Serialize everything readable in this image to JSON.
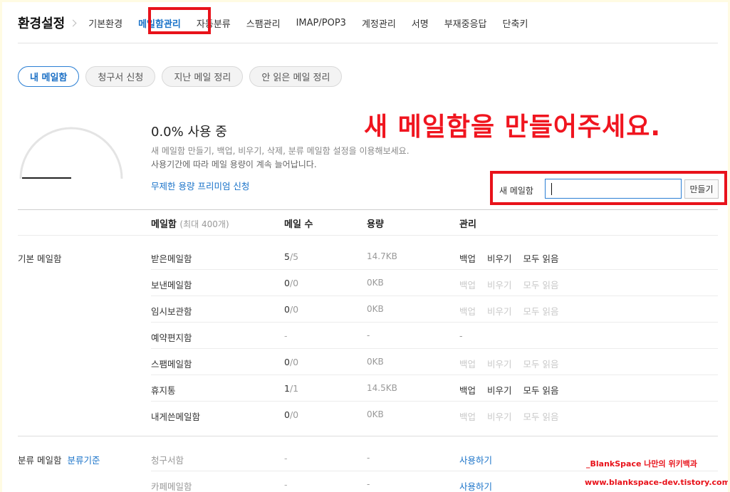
{
  "nav": {
    "title": "환경설정",
    "items": [
      "기본환경",
      "메일함관리",
      "자동분류",
      "스팸관리",
      "IMAP/POP3",
      "계정관리",
      "서명",
      "부재중응답",
      "단축키"
    ]
  },
  "tabs": [
    "내 메일함",
    "청구서 신청",
    "지난 메일 정리",
    "안 읽은 메일 정리"
  ],
  "usage": {
    "title": "0.0% 사용 중",
    "percent": 0.0,
    "desc1": "새 메일함 만들기, 백업, 비우기, 삭제, 분류 메일함 설정을 이용해보세요.",
    "desc2": "사용기간에 따라 메일 용량이 계속 늘어납니다.",
    "premium_link": "무제한 용량 프리미엄 신청"
  },
  "overlay_message": "새 메일함을 만들어주세요.",
  "new_mailbox": {
    "label": "새 메일함",
    "value": "",
    "button": "만들기"
  },
  "table": {
    "headers": {
      "mailbox": "메일함",
      "mailbox_sub": "(최대 400개)",
      "count": "메일 수",
      "size": "용량",
      "manage": "관리"
    },
    "groups": [
      {
        "label": "기본 메일함",
        "rows": [
          {
            "name": "받은메일함",
            "count": "5",
            "total": "/5",
            "size": "14.7KB",
            "actions": [
              "백업",
              "비우기",
              "모두 읽음"
            ],
            "active": true
          },
          {
            "name": "보낸메일함",
            "count": "0",
            "total": "/0",
            "size": "0KB",
            "actions": [
              "백업",
              "비우기",
              "모두 읽음"
            ],
            "active": false
          },
          {
            "name": "임시보관함",
            "count": "0",
            "total": "/0",
            "size": "0KB",
            "actions": [
              "백업",
              "비우기",
              "모두 읽음"
            ],
            "active": false
          },
          {
            "name": "예약편지함",
            "count": "-",
            "total": "",
            "size": "-",
            "actions": [
              "-"
            ],
            "active": false
          },
          {
            "name": "스팸메일함",
            "count": "0",
            "total": "/0",
            "size": "0KB",
            "actions": [
              "백업",
              "비우기",
              "모두 읽음"
            ],
            "active": false
          },
          {
            "name": "휴지통",
            "count": "1",
            "total": "/1",
            "size": "14.5KB",
            "actions": [
              "백업",
              "비우기",
              "모두 읽음"
            ],
            "active": true
          },
          {
            "name": "내게쓴메일함",
            "count": "0",
            "total": "/0",
            "size": "0KB",
            "actions": [
              "백업",
              "비우기",
              "모두 읽음"
            ],
            "active": false
          }
        ]
      },
      {
        "label": "분류 메일함",
        "link": "분류기준",
        "rows": [
          {
            "name": "청구서함",
            "count": "-",
            "size": "-",
            "action": "사용하기"
          },
          {
            "name": "카페메일함",
            "count": "-",
            "size": "-",
            "action": "사용하기"
          }
        ]
      }
    ]
  },
  "watermark": {
    "line1": "_BlankSpace 나만의 위키백과",
    "line2": "www.blankspace-dev.tistory.com"
  },
  "colors": {
    "accent": "#1a73c9",
    "highlight_red": "#e8121a",
    "background": "#fffbe3"
  }
}
